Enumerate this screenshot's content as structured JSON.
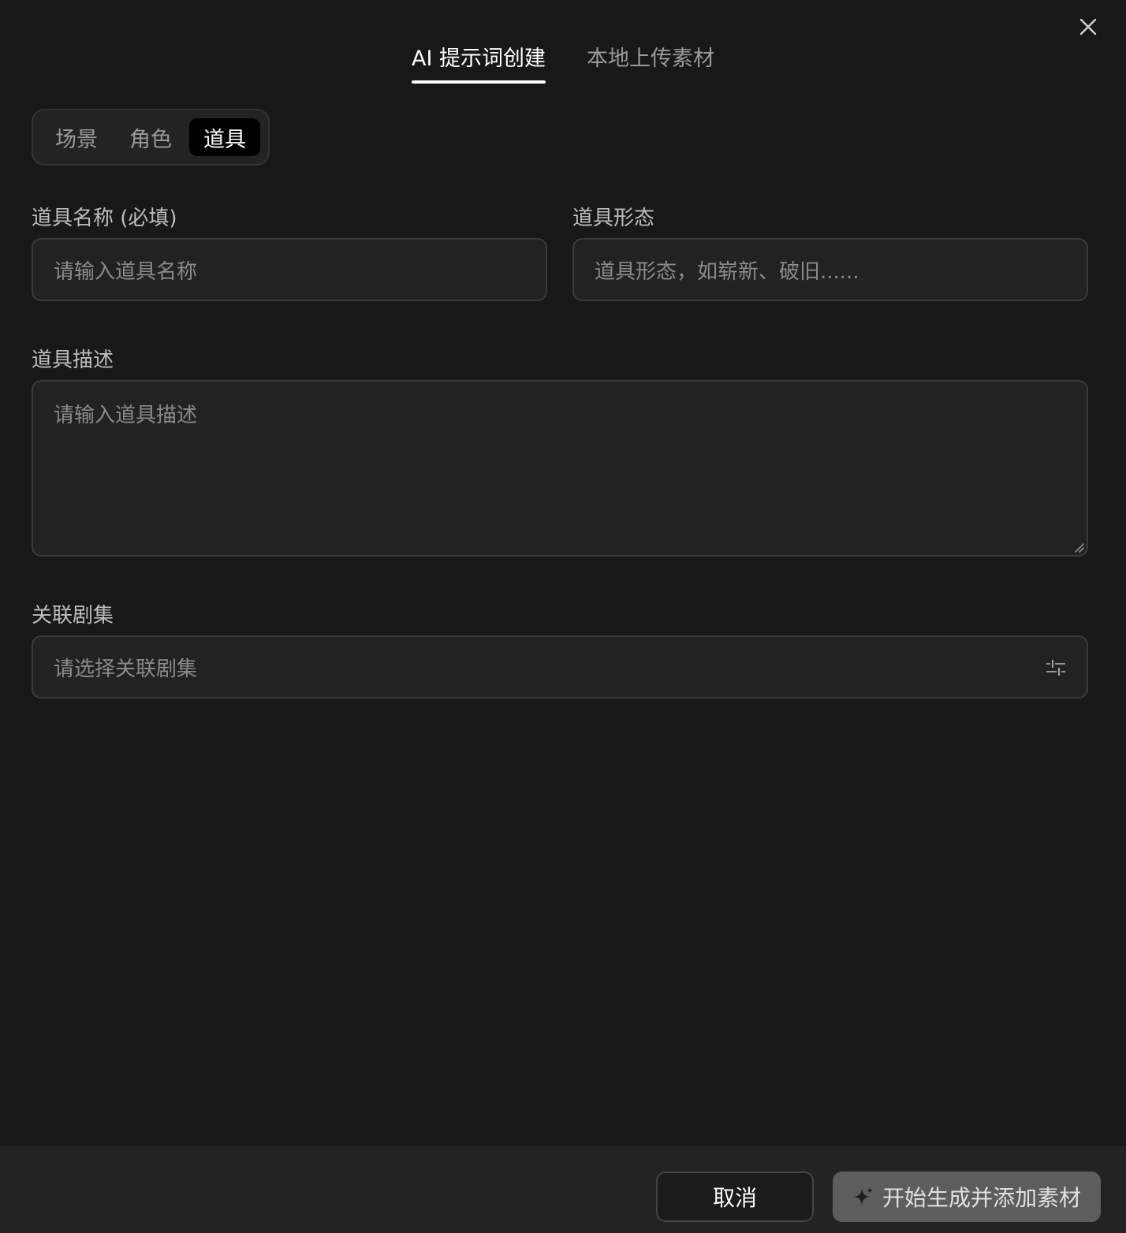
{
  "dialog": {
    "close_icon": "close-icon",
    "tabs": [
      {
        "label": "AI 提示词创建",
        "active": true
      },
      {
        "label": "本地上传素材",
        "active": false
      }
    ],
    "segments": [
      {
        "label": "场景",
        "active": false
      },
      {
        "label": "角色",
        "active": false
      },
      {
        "label": "道具",
        "active": true
      }
    ]
  },
  "form": {
    "name": {
      "label": "道具名称 (必填)",
      "placeholder": "请输入道具名称",
      "value": ""
    },
    "form_state": {
      "label": "道具形态",
      "placeholder": "道具形态，如崭新、破旧......",
      "value": ""
    },
    "description": {
      "label": "道具描述",
      "placeholder": "请输入道具描述",
      "value": ""
    },
    "episodes": {
      "label": "关联剧集",
      "placeholder": "请选择关联剧集",
      "icon": "sliders-icon"
    }
  },
  "footer": {
    "cancel_label": "取消",
    "generate_label": "开始生成并添加素材",
    "generate_icon": "sparkle-icon"
  }
}
